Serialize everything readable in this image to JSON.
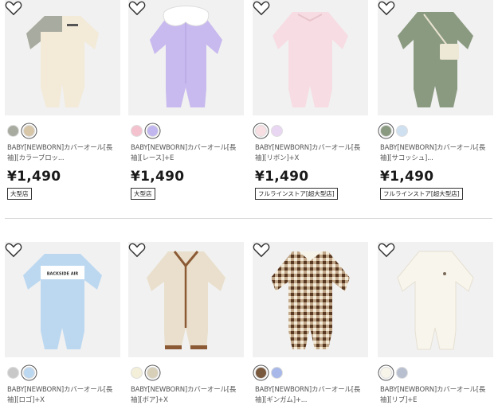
{
  "products": [
    {
      "name_line1": "BABY[NEWBORN]カバーオール[長",
      "name_line2": "袖][カラーブロッ...",
      "price": "¥1,490",
      "tag": "大型店",
      "swatches": [
        "#a8aba0",
        "#d8c6a8"
      ],
      "selected": 1,
      "image": "colorblock-coverall"
    },
    {
      "name_line1": "BABY[NEWBORN]カバーオール[長",
      "name_line2": "袖][レース]+E",
      "price": "¥1,490",
      "tag": "大型店",
      "swatches": [
        "#f3c2ce",
        "#c2b6ef"
      ],
      "selected": 1,
      "image": "lace-coverall"
    },
    {
      "name_line1": "BABY[NEWBORN]カバーオール[長",
      "name_line2": "袖][リボン]+X",
      "price": "¥1,490",
      "tag": "フルラインストア[超大型店]",
      "swatches": [
        "#f7dfe3",
        "#e9d6f2"
      ],
      "selected": 0,
      "image": "ribbon-coverall"
    },
    {
      "name_line1": "BABY[NEWBORN]カバーオール[長",
      "name_line2": "袖][サコッシュ]...",
      "price": "¥1,490",
      "tag": "フルラインストア[超大型店]",
      "swatches": [
        "#8a9a80",
        "#cfe0f1"
      ],
      "selected": 0,
      "image": "sacoche-coverall"
    },
    {
      "name_line1": "BABY[NEWBORN]カバーオール[長",
      "name_line2": "袖][ロゴ]+X",
      "price": "",
      "tag": "",
      "swatches": [
        "#c8c8c8",
        "#bcd8f1"
      ],
      "selected": 1,
      "image": "logo-coverall"
    },
    {
      "name_line1": "BABY[NEWBORN]カバーオール[長",
      "name_line2": "袖][ボア]+X",
      "price": "",
      "tag": "",
      "swatches": [
        "#f3efd8",
        "#d8cfb8"
      ],
      "selected": 1,
      "image": "boa-coverall"
    },
    {
      "name_line1": "BABY[NEWBORN]カバーオール[長",
      "name_line2": "袖][ギンガム]+...",
      "price": "",
      "tag": "",
      "swatches": [
        "#7a5a3f",
        "#a8b8e8"
      ],
      "selected": 0,
      "image": "gingham-coverall"
    },
    {
      "name_line1": "BABY[NEWBORN]カバーオール[長",
      "name_line2": "袖][リブ]+E",
      "price": "",
      "tag": "",
      "swatches": [
        "#f7f4ea",
        "#b8c0d0"
      ],
      "selected": 0,
      "image": "rib-coverall"
    }
  ],
  "logo_text": "BACKSIDE AIR",
  "colors": {
    "thumb_bg": "#f1f1f1",
    "price": "#1a1a1a",
    "divider": "#d8d8d8"
  }
}
